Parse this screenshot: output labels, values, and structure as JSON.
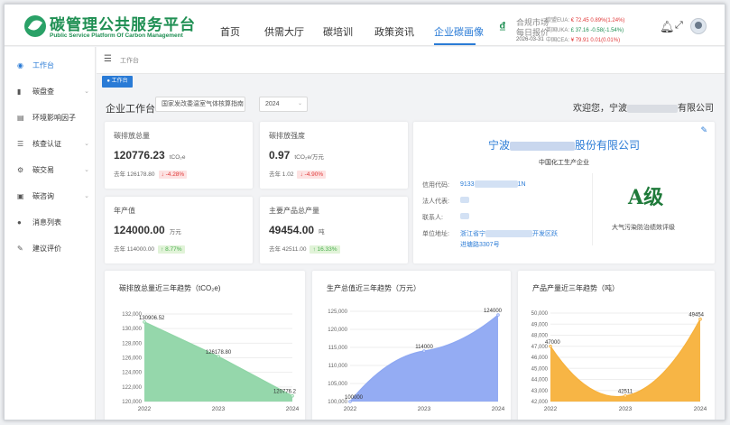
{
  "header": {
    "brand_cn": "碳管理公共服务平台",
    "brand_en": "Public Service Platform Of Carbon Management",
    "nav": [
      "首页",
      "供需大厅",
      "碳培训",
      "政策资讯",
      "企业碳画像"
    ],
    "active_nav": "企业碳画像",
    "market_title1": "合规市场",
    "market_title2": "每日报价",
    "market_date": "2026-03-31",
    "prices": [
      {
        "label": "欧盟EUA:",
        "value": "€ 72.45",
        "change": "0.89%(1.24%)",
        "dir": "up"
      },
      {
        "label": "英国UKA:",
        "value": "£ 37.16",
        "change": "-0.58(-1.54%)",
        "dir": "down"
      },
      {
        "label": "中国CEA:",
        "value": "¥ 79.91",
        "change": "0.01(0.01%)",
        "dir": "up"
      }
    ]
  },
  "sidebar": {
    "items": [
      {
        "label": "工作台",
        "icon": "dashboard-icon",
        "active": true,
        "arrow": false
      },
      {
        "label": "碳盘查",
        "icon": "bar-chart-icon",
        "active": false,
        "arrow": true
      },
      {
        "label": "环境影响因子",
        "icon": "list-icon",
        "active": false,
        "arrow": false
      },
      {
        "label": "核查认证",
        "icon": "checklist-icon",
        "active": false,
        "arrow": true
      },
      {
        "label": "碳交易",
        "icon": "gear-icon",
        "active": false,
        "arrow": true
      },
      {
        "label": "碳咨询",
        "icon": "message-icon",
        "active": false,
        "arrow": true
      },
      {
        "label": "消息列表",
        "icon": "chat-icon",
        "active": false,
        "arrow": false
      },
      {
        "label": "建议评价",
        "icon": "edit-icon",
        "active": false,
        "arrow": false
      }
    ]
  },
  "breadcrumb": "工作台",
  "active_tag": "● 工作台",
  "page": {
    "title": "企业工作台",
    "standard_select": "国家发改委温室气体核算指南",
    "year_select": "2024",
    "welcome_prefix": "欢迎您，宁波",
    "welcome_suffix": "有限公司"
  },
  "kpis": [
    {
      "label": "碳排放总量",
      "value": "120776.23",
      "unit": "tCO₂e",
      "prev": "去年 126178.80",
      "change": "↓ -4.28%",
      "dir": "down"
    },
    {
      "label": "碳排放强度",
      "value": "0.97",
      "unit": "tCO₂e/万元",
      "prev": "去年 1.02",
      "change": "↓ -4.90%",
      "dir": "down"
    },
    {
      "label": "年产值",
      "value": "124000.00",
      "unit": "万元",
      "prev": "去年 114000.00",
      "change": "↑ 8.77%",
      "dir": "up"
    },
    {
      "label": "主要产品总产量",
      "value": "49454.00",
      "unit": "吨",
      "prev": "去年 42511.00",
      "change": "↑ 16.33%",
      "dir": "up"
    }
  ],
  "company": {
    "name_prefix": "宁波",
    "name_suffix": "股份有限公司",
    "industry": "中国化工生产企业",
    "fields": [
      {
        "label": "信用代码:",
        "value_prefix": "9133",
        "value_suffix": "1N"
      },
      {
        "label": "法人代表:",
        "value_prefix": "",
        "value_suffix": ""
      },
      {
        "label": "联系人:",
        "value_prefix": "",
        "value_suffix": ""
      },
      {
        "label": "单位地址:",
        "value_prefix": "浙江省宁",
        "value_suffix": "开发区跃"
      }
    ],
    "address_line2": "进塘路3307号",
    "grade": "A级",
    "grade_label": "大气污染防治绩效评级"
  },
  "chart_data": [
    {
      "type": "area",
      "title": "碳排放总量近三年趋势（tCO₂e)",
      "x": [
        "2022",
        "2023",
        "2024"
      ],
      "values": [
        130906.52,
        126178.8,
        120776.23
      ],
      "labels": [
        "130906.52",
        "126178.80",
        "120776.2"
      ],
      "ylim": [
        120000,
        132000
      ],
      "yticks": [
        "120,000",
        "122,000",
        "124,000",
        "126,000",
        "128,000",
        "130,000",
        "132,000"
      ],
      "color": "#8fd5a6"
    },
    {
      "type": "area",
      "title": "生产总值近三年趋势（万元）",
      "x": [
        "2022",
        "2023",
        "2024"
      ],
      "values": [
        100000,
        114000,
        124000
      ],
      "labels": [
        "100000",
        "114000",
        "124000"
      ],
      "ylim": [
        100000,
        125000
      ],
      "yticks": [
        "100,000",
        "105,000",
        "110,000",
        "115,000",
        "120,000",
        "125,000"
      ],
      "color": "#8ea8f2"
    },
    {
      "type": "area",
      "title": "产品产量近三年趋势（吨）",
      "x": [
        "2022",
        "2023",
        "2024"
      ],
      "values": [
        47000,
        42511,
        49454
      ],
      "labels": [
        "47000",
        "42511",
        "49454"
      ],
      "ylim": [
        42000,
        50000
      ],
      "yticks": [
        "42,000",
        "43,000",
        "44,000",
        "45,000",
        "46,000",
        "47,000",
        "48,000",
        "49,000",
        "50,000"
      ],
      "color": "#f7b13b"
    }
  ]
}
